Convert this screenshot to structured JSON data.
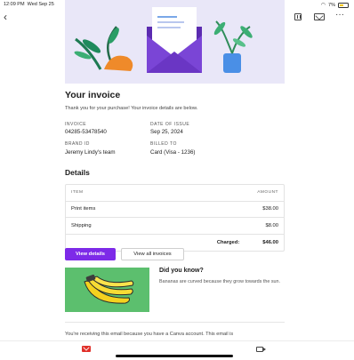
{
  "status_bar": {
    "time": "12:09 PM",
    "date": "Wed Sep 25",
    "dots": "• • •",
    "battery": "7%"
  },
  "toolbar": {
    "icons": [
      "back-icon",
      "archive-icon",
      "trash-icon",
      "mail-icon",
      "more-icon"
    ],
    "back_glyph": "‹",
    "more_glyph": "···"
  },
  "hero": {
    "icon": "invoice-envelope-illustration",
    "background": "#e9e7f8"
  },
  "invoice": {
    "title": "Your invoice",
    "intro": "Thank you for your purchase! Your invoice details are below.",
    "fields": [
      {
        "label": "INVOICE",
        "value": "04285-53478540"
      },
      {
        "label": "DATE OF ISSUE",
        "value": "Sep 25, 2024"
      },
      {
        "label": "BRAND ID",
        "value": "Jeremy Lindy's team"
      },
      {
        "label": "BILLED TO",
        "value": "Card (Visa - 1236)"
      }
    ]
  },
  "details": {
    "heading": "Details",
    "columns": [
      "ITEM",
      "AMOUNT"
    ],
    "rows": [
      {
        "item": "Print items",
        "amount": "$38.00"
      },
      {
        "item": "Shipping",
        "amount": "$8.00"
      }
    ],
    "charged_label": "Charged:",
    "charged_amount": "$46.00"
  },
  "actions": {
    "view_details": "View details",
    "view_all": "View all invoices",
    "accent": "#7d2ae8"
  },
  "did_you_know": {
    "title": "Did you know?",
    "text": "Bananas are curved because they grow towards the sun.",
    "image_icon": "banana-illustration",
    "card_color": "#5cbf6e"
  },
  "footer": {
    "text": "You're receiving this email because you have a Canva account. This email is"
  },
  "bottom_nav": {
    "icons": [
      "gmail-icon",
      "meet-icon"
    ]
  }
}
